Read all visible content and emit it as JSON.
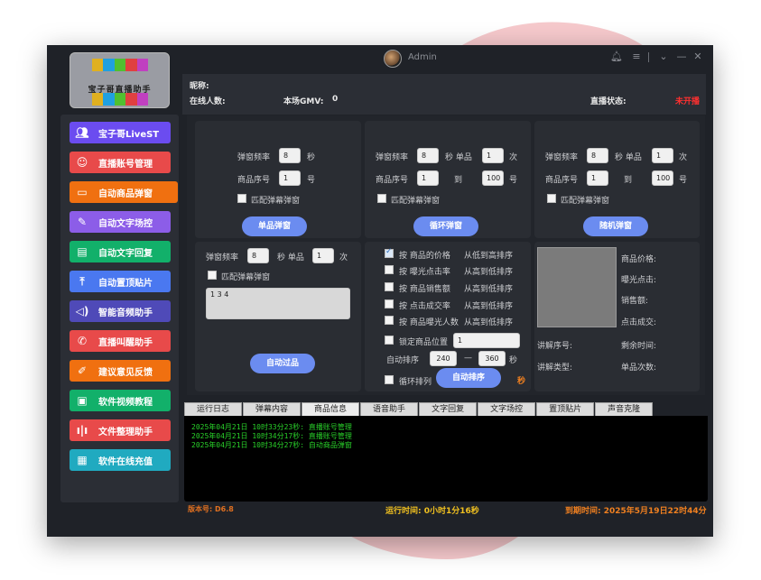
{
  "titlebar": {
    "user": "Admin",
    "icons": [
      "bell-icon",
      "menu-icon",
      "divider",
      "chevron-down-icon",
      "minimize-icon",
      "close-icon"
    ]
  },
  "logo": {
    "text": "宝子哥直播助手",
    "block_colors": [
      "#e0b020",
      "#20a0e0",
      "#50c030",
      "#e04040",
      "#c040c0"
    ]
  },
  "sidebar": {
    "items": [
      {
        "label": "宝子哥LiveST",
        "color": "#6b4cf0",
        "icon": "users-icon"
      },
      {
        "label": "直播账号管理",
        "color": "#e84a4a",
        "icon": "user-icon"
      },
      {
        "label": "自动商品弹窗",
        "color": "#f07010",
        "icon": "window-icon"
      },
      {
        "label": "自动文字场控",
        "color": "#8c5de8",
        "icon": "pen-icon"
      },
      {
        "label": "自动文字回复",
        "color": "#12b06a",
        "icon": "chat-icon"
      },
      {
        "label": "自动置顶贴片",
        "color": "#4a78f0",
        "icon": "pin-top-icon"
      },
      {
        "label": "智能音频助手",
        "color": "#4f4ab8",
        "icon": "speaker-icon"
      },
      {
        "label": "直播叫醒助手",
        "color": "#e84a4a",
        "icon": "phone-icon"
      },
      {
        "label": "建议意见反馈",
        "color": "#f07010",
        "icon": "edit-icon"
      },
      {
        "label": "软件视频教程",
        "color": "#12b06a",
        "icon": "monitor-icon"
      },
      {
        "label": "文件整理助手",
        "color": "#e84a4a",
        "icon": "audio-wave-icon"
      },
      {
        "label": "软件在线充值",
        "color": "#20aac0",
        "icon": "document-icon"
      }
    ]
  },
  "info": {
    "nickname_label": "昵称:",
    "online_label": "在线人数:",
    "gmv_label": "本场GMV:",
    "gmv_value": "0",
    "live_status_label": "直播状态:",
    "live_status_value": "未开播",
    "status_color": "#ff3030"
  },
  "panel1": {
    "freq_label": "弹窗频率",
    "freq_value": "8",
    "sec": "秒",
    "item_label": "商品序号",
    "item_value": "1",
    "hao": "号",
    "match_label": "匹配弹幕弹窗",
    "button": "单品弹窗"
  },
  "panel2": {
    "freq_label": "弹窗频率",
    "freq_value": "8",
    "sec_single": "秒 单品",
    "single_value": "1",
    "ci": "次",
    "item_label": "商品序号",
    "from_value": "1",
    "to": "到",
    "to_value": "100",
    "hao": "号",
    "match_label": "匹配弹幕弹窗",
    "button": "循环弹窗"
  },
  "panel3": {
    "freq_label": "弹窗频率",
    "freq_value": "8",
    "sec_single": "秒 单品",
    "single_value": "1",
    "ci": "次",
    "item_label": "商品序号",
    "from_value": "1",
    "to": "到",
    "to_value": "100",
    "hao": "号",
    "match_label": "匹配弹幕弹窗",
    "button": "随机弹窗"
  },
  "panel4": {
    "freq_label": "弹窗频率",
    "freq_value": "8",
    "sec_single": "秒 单品",
    "single_value": "1",
    "ci": "次",
    "match_label": "匹配弹幕弹窗",
    "keywords": "1 3 4",
    "button": "自动过品"
  },
  "sort": {
    "options": [
      {
        "label": "按 商品的价格",
        "order": "从低到高排序",
        "checked": true
      },
      {
        "label": "按 曝光点击率",
        "order": "从高到低排序",
        "checked": false
      },
      {
        "label": "按 商品销售额",
        "order": "从高到低排序",
        "checked": false
      },
      {
        "label": "按 点击成交率",
        "order": "从高到低排序",
        "checked": false
      },
      {
        "label": "按 商品曝光人数",
        "order": "从高到低排序",
        "checked": false
      }
    ],
    "lock_label": "锁定商品位置",
    "lock_value": "1",
    "auto_label": "自动排序",
    "min_value": "240",
    "dash": "—",
    "max_value": "360",
    "sec": "秒",
    "loop_label": "循环排列",
    "button": "自动排序",
    "sec_orange": "秒"
  },
  "stats": {
    "price": "商品价格:",
    "exposure": "曝光点击:",
    "sales": "销售额:",
    "conversion": "点击成交:",
    "seq": "讲解序号:",
    "remain": "剩余时间:",
    "type": "讲解类型:",
    "count": "单品次数:"
  },
  "tabs": [
    "运行日志",
    "弹幕内容",
    "商品信息",
    "语音助手",
    "文字回复",
    "文字场控",
    "置顶贴片",
    "声音克隆"
  ],
  "selected_tab": "商品信息",
  "log": [
    "2025年04月21日  10时33分23秒:  直播账号管理",
    "2025年04月21日  10时34分17秒:  直播账号管理",
    "2025年04月21日  10时34分27秒:  自动商品弹窗"
  ],
  "footer": {
    "version": "版本号: D6.8",
    "runtime": "运行时间: 0小时1分16秒",
    "expire": "到期时间: 2025年5月19日22时44分"
  }
}
